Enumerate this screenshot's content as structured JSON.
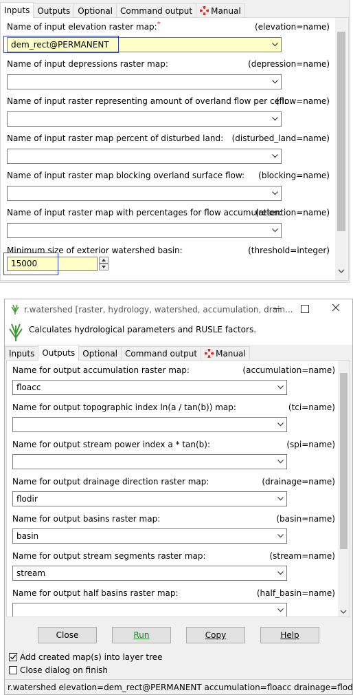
{
  "panel1": {
    "tabs": [
      "Inputs",
      "Outputs",
      "Optional",
      "Command output",
      "Manual"
    ],
    "active_tab": "Inputs",
    "fields": [
      {
        "label": "Name of input elevation raster map:",
        "required": "*",
        "param": "(elevation=name)",
        "value": "dem_rect@PERMANENT"
      },
      {
        "label": "Name of input depressions raster map:",
        "param": "(depression=name)",
        "value": ""
      },
      {
        "label": "Name of input raster representing amount of overland flow per cell:",
        "param": "(flow=name)",
        "value": ""
      },
      {
        "label": "Name of input raster map percent of disturbed land:",
        "param": "(disturbed_land=name)",
        "value": ""
      },
      {
        "label": "Name of input raster map blocking overland surface flow:",
        "param": "(blocking=name)",
        "value": ""
      },
      {
        "label": "Name of input raster map with percentages for flow accumulation:",
        "param": "(retention=name)",
        "value": ""
      }
    ],
    "threshold": {
      "label": "Minimum size of exterior watershed basin:",
      "param": "(threshold=integer)",
      "value": "15000"
    }
  },
  "window": {
    "title": "r.watershed [raster, hydrology, watershed, accumulation, drain...",
    "description": "Calculates hydrological parameters and RUSLE factors.",
    "tabs": [
      "Inputs",
      "Outputs",
      "Optional",
      "Command output",
      "Manual"
    ],
    "active_tab": "Outputs",
    "fields": [
      {
        "label": "Name for output accumulation raster map:",
        "param": "(accumulation=name)",
        "value": "floacc"
      },
      {
        "label": "Name for output topographic index ln(a / tan(b)) map:",
        "param": "(tci=name)",
        "value": ""
      },
      {
        "label": "Name for output stream power index a * tan(b):",
        "param": "(spi=name)",
        "value": ""
      },
      {
        "label": "Name for output drainage direction raster map:",
        "param": "(drainage=name)",
        "value": "flodir"
      },
      {
        "label": "Name for output basins raster map:",
        "param": "(basin=name)",
        "value": "basin"
      },
      {
        "label": "Name for output stream segments raster map:",
        "param": "(stream=name)",
        "value": "stream"
      },
      {
        "label": "Name for output half basins raster map:",
        "param": "(half_basin=name)",
        "value": ""
      }
    ],
    "buttons": {
      "close": "Close",
      "run": "Run",
      "copy": "Copy",
      "help": "Help"
    },
    "checkboxes": [
      {
        "label": "Add created map(s) into layer tree",
        "checked": true
      },
      {
        "label": "Close dialog on finish",
        "checked": false
      }
    ],
    "status": "r.watershed elevation=dem_rect@PERMANENT accumulation=floacc drainage=flodir bas..."
  },
  "icons": {
    "tab_manual": "lifebuoy-icon",
    "combo": "chevron-down-icon",
    "app": "grass-icon"
  }
}
